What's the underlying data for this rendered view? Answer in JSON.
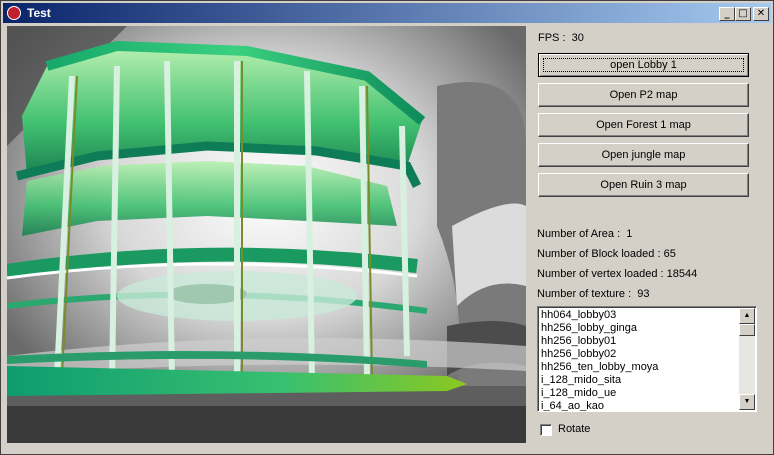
{
  "window": {
    "title": "Test",
    "controls": {
      "minimize": "_",
      "maximize": "□",
      "close": "✕"
    }
  },
  "fps": {
    "label": "FPS :",
    "value": "30"
  },
  "buttons": [
    {
      "label": "open Lobby 1"
    },
    {
      "label": "Open P2 map"
    },
    {
      "label": "Open Forest 1 map"
    },
    {
      "label": "Open jungle map"
    },
    {
      "label": "Open Ruin 3 map"
    }
  ],
  "stats": [
    {
      "label": "Number of Area :",
      "value": "1"
    },
    {
      "label": "Number of Block loaded :",
      "value": "65"
    },
    {
      "label": "Number of vertex loaded :",
      "value": "18544"
    },
    {
      "label": "Number of texture :",
      "value": "93"
    }
  ],
  "texture_list": {
    "items": [
      "hh064_lobby03",
      "hh256_lobby_ginga",
      "hh256_lobby01",
      "hh256_lobby02",
      "hh256_ten_lobby_moya",
      "i_128_mido_sita",
      "i_128_mido_ue",
      "i_64_ao_kao"
    ],
    "scroll_up": "▲",
    "scroll_down": "▼"
  },
  "rotate": {
    "label": "Rotate",
    "checked": false
  },
  "colors": {
    "title_start": "#0a246a",
    "title_end": "#a6caf0",
    "face": "#d4d0c8"
  },
  "scene": {
    "description_icon": "3d-viewport"
  }
}
